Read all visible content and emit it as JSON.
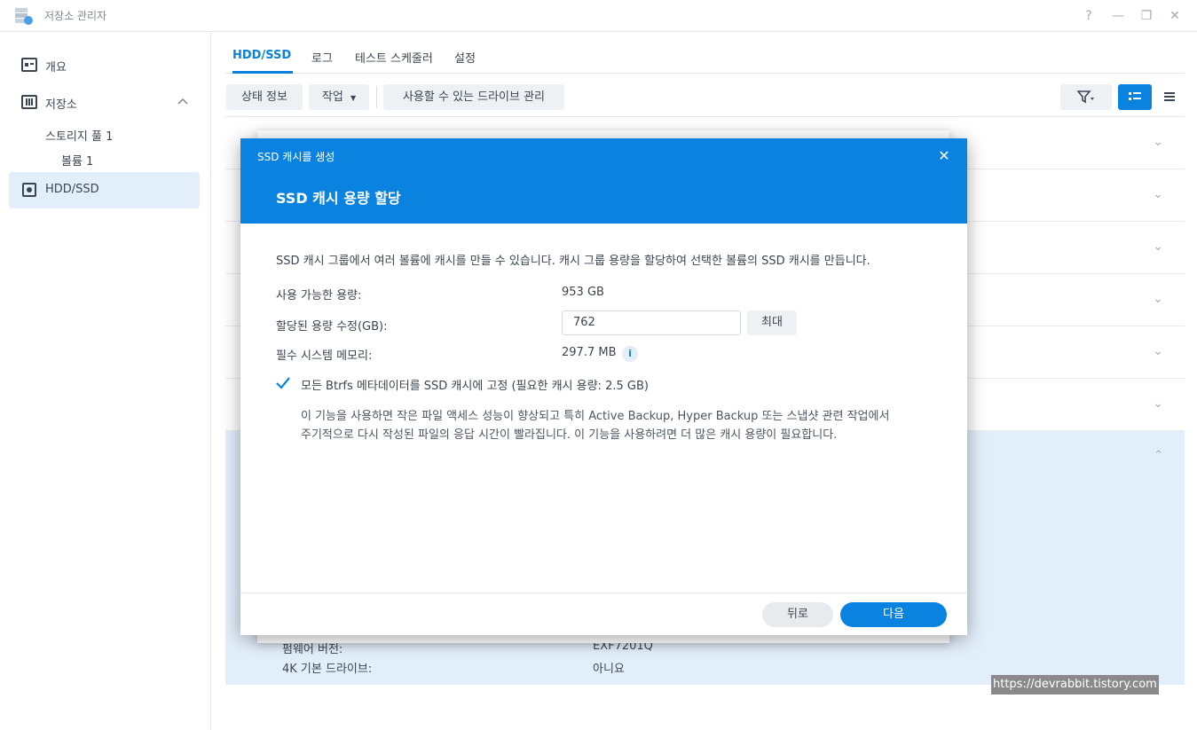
{
  "window": {
    "title": "저장소 관리자",
    "controls": [
      "?",
      "—",
      "❐",
      "✕"
    ]
  },
  "sidebar": {
    "items": [
      {
        "label": "개요",
        "icon": "overview-icon"
      },
      {
        "label": "저장소",
        "icon": "storage-icon"
      },
      {
        "label": "HDD/SSD",
        "icon": "hdd-icon"
      }
    ],
    "sub_items": [
      "스토리지 풀 1",
      "볼륨 1"
    ]
  },
  "tabs": [
    "HDD/SSD",
    "로그",
    "테스트 스케줄러",
    "설정"
  ],
  "toolbar": {
    "status_label": "상태 정보",
    "action_label": "작업",
    "manage_label": "사용할 수 있는 드라이브 관리"
  },
  "background_rows": {
    "expanded_labels": [
      {
        "label": "펌웨어 버전:",
        "value": "EXF7201Q"
      },
      {
        "label": "4K 기본 드라이브:",
        "value": "아니요"
      }
    ]
  },
  "modal": {
    "wizard_title": "SSD 캐시를 생성",
    "step_title": "SSD 캐시 용량 할당",
    "description": "SSD 캐시 그룹에서 여러 볼륨에 캐시를 만들 수 있습니다. 캐시 그룹 용량을 할당하여 선택한 볼륨의 SSD 캐시를 만듭니다.",
    "available_label": "사용 가능한 용량:",
    "available_value": "953 GB",
    "alloc_label": "할당된 용량 수정(GB):",
    "alloc_value": "762",
    "max_button": "최대",
    "memory_label": "필수 시스템 메모리:",
    "memory_value": "297.7 MB",
    "pin_checkbox_label": "모든 Btrfs 메타데이터를 SSD 캐시에 고정 (필요한 캐시 용량: 2.5 GB)",
    "pin_checked": true,
    "pin_note_line1": "이 기능을 사용하면 작은 파일 액세스 성능이 향상되고 특히 Active Backup, Hyper Backup 또는 스냅샷 관련 작업에서",
    "pin_note_line2": "주기적으로 다시 작성된 파일의 응답 시간이 빨라집니다. 이 기능을 사용하려면 더 많은 캐시 용량이 필요합니다.",
    "back_button": "뒤로",
    "next_button": "다음"
  },
  "watermark": "https://devrabbit.tistory.com",
  "colors": {
    "accent": "#0a82e0",
    "active_bg": "#e3eefb"
  }
}
